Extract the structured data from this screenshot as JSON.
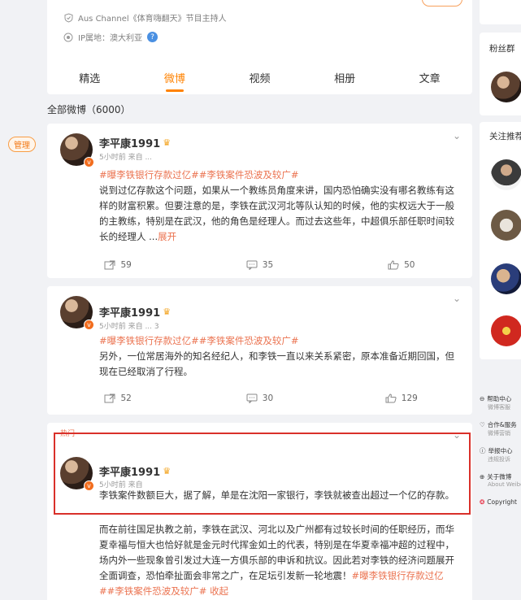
{
  "left": {
    "manage_label": "管理"
  },
  "profile": {
    "title_line": "Aus Channel《体育嗨翻天》节目主持人",
    "ip_line": "IP属地：澳大利亚"
  },
  "tabs": [
    "精选",
    "微博",
    "视频",
    "相册",
    "文章"
  ],
  "active_tab": 1,
  "all_weibo": "全部微博（6000）",
  "posts": [
    {
      "name": "李平康1991",
      "meta": "5小时前 来自 ...",
      "tags": "#曝李铁银行存款过亿##李铁案件恐波及较广#",
      "text": "说到过亿存款这个问题，如果从一个教练员角度来讲，国内恐怕确实没有哪名教练有这样的财富积累。但要注意的是，李铁在武汉河北等队认知的时候，他的实权远大于一般的主教练，特别是在武汉，他的角色是经理人。而过去这些年，中超俱乐部任职时间较长的经理人 ...",
      "more": "展开",
      "repost": "59",
      "comment": "35",
      "like": "50"
    },
    {
      "name": "李平康1991",
      "meta": "5小时前 来自 ...        3",
      "tags": "#曝李铁银行存款过亿##李铁案件恐波及较广#",
      "text": "另外，一位常居海外的知名经纪人，和李铁一直以来关系紧密，原本准备近期回国，但现在已经取消了行程。",
      "repost": "52",
      "comment": "30",
      "like": "129"
    },
    {
      "hot": "热门",
      "name": "李平康1991",
      "meta": "5小时前 来自",
      "first_text": "李铁案件数额巨大，据了解，单是在沈阳一家银行，李铁就被查出超过一个亿的存款。",
      "text": "而在前往国足执教之前，李铁在武汉、河北以及广州都有过较长时间的任职经历，而华夏幸福与恒大也恰好就是金元时代挥金如土的代表，特别是在华夏幸福冲超的过程中，场内外一些现象曾引发过大连一方俱乐部的申诉和抗议。因此若对李铁的经济问题展开全面调查，恐怕牵扯面会非常之广，在足坛引发新一轮地震！",
      "tags": "#曝李铁银行存款过亿##李铁案件恐波及较广#",
      "collapse": "收起"
    }
  ],
  "sidebar": {
    "fans_group": "粉丝群",
    "follow_rec": "关注推荐",
    "links": [
      {
        "title": "帮助中心",
        "sub": "微博客服"
      },
      {
        "title": "合作&服务",
        "sub": "微博营销"
      },
      {
        "title": "举报中心",
        "sub": "违规投诉"
      },
      {
        "title": "关于微博",
        "sub": "About Weibo"
      },
      {
        "title": "Copyright",
        "sub": ""
      }
    ]
  }
}
